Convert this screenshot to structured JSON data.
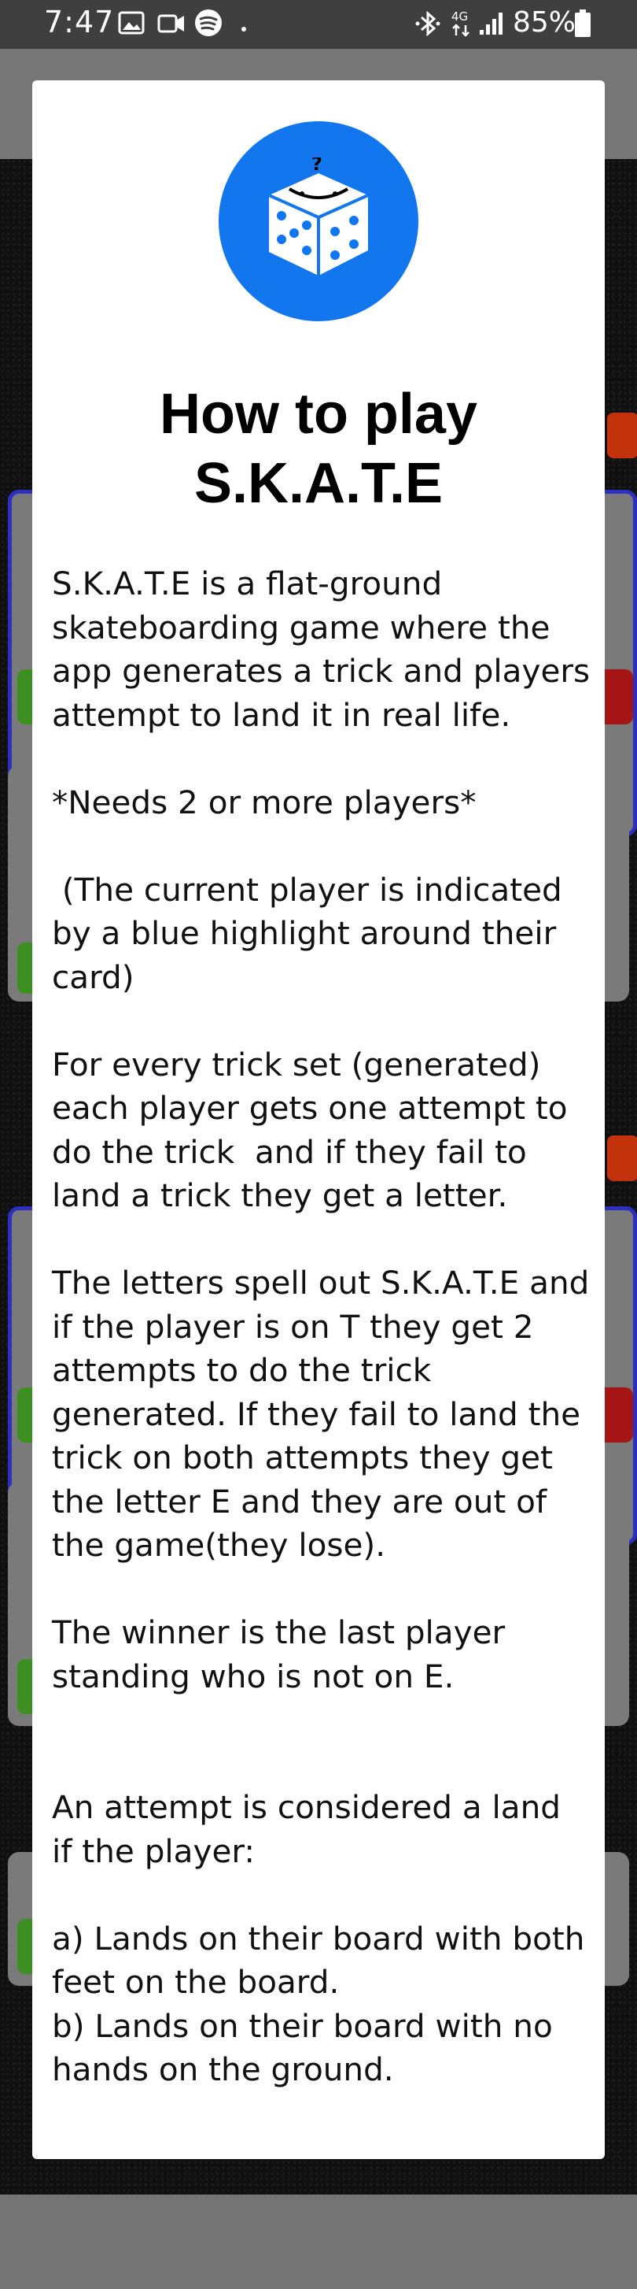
{
  "status_bar": {
    "time": "7:47",
    "battery": "85%",
    "network": "4G",
    "icons": [
      "image-icon",
      "video-icon",
      "spotify-icon",
      "dot-icon",
      "bluetooth-icon",
      "network-4g-icon",
      "signal-icon",
      "battery-icon"
    ]
  },
  "dialog": {
    "title": "How to play\nS.K.A.T.E",
    "logo_icon": "dice-icon",
    "body": "S.K.A.T.E is a flat-ground skateboarding game where the app generates a trick and players attempt to land it in real life.\n\n*Needs 2 or more players*\n\n (The current player is indicated by a blue highlight around their card)\n\nFor every trick set (generated) each player gets one attempt to do the trick  and if they fail to land a trick they get a letter.\n\nThe letters spell out S.K.A.T.E and if the player is on T they get 2 attempts to do the trick generated. If they fail to land the trick on both attempts they get the letter E and they are out of the game(they lose).\n\nThe winner is the last player standing who is not on E.\n\n\nAn attempt is considered a land if the player:\n\na) Lands on their board with both feet on the board.\nb) Lands on their board with no hands on the ground."
  },
  "colors": {
    "dialog_background": "#ffffff",
    "logo_background": "#1277ee",
    "status_bar": "#3f3f3f",
    "highlight": "#2c2fbf"
  }
}
